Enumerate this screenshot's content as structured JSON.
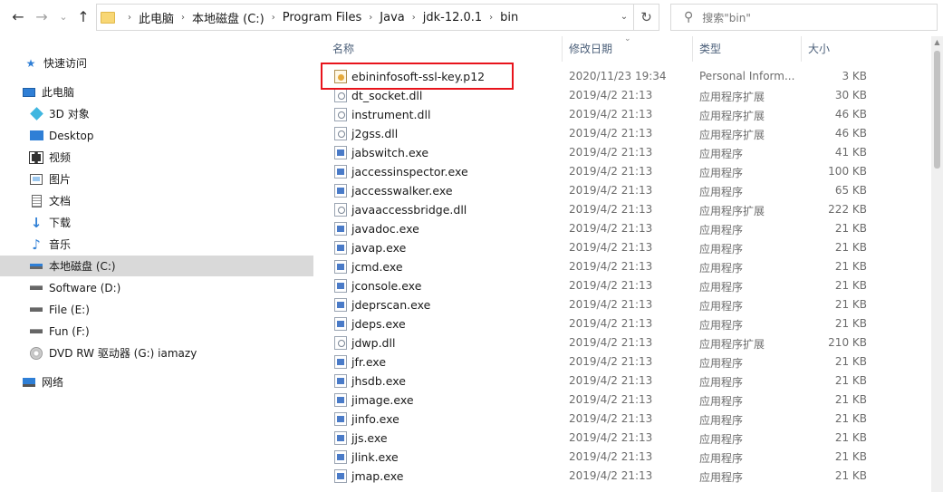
{
  "nav": {
    "back": "←",
    "forward": "→",
    "history": "⌄",
    "up": "↑"
  },
  "address": {
    "crumbs": [
      "此电脑",
      "本地磁盘 (C:)",
      "Program Files",
      "Java",
      "jdk-12.0.1",
      "bin"
    ],
    "refresh": "↻",
    "dropdown": "⌄"
  },
  "search": {
    "placeholder": "搜索\"bin\"",
    "icon": "search-icon"
  },
  "sidebar": {
    "quick_access": "快速访问",
    "this_pc": "此电脑",
    "items": [
      "3D 对象",
      "Desktop",
      "视频",
      "图片",
      "文档",
      "下载",
      "音乐",
      "本地磁盘 (C:)",
      "Software (D:)",
      "File (E:)",
      "Fun (F:)",
      "DVD RW 驱动器 (G:) iamazy"
    ],
    "network": "网络"
  },
  "columns": {
    "name": "名称",
    "date": "修改日期",
    "type": "类型",
    "size": "大小"
  },
  "files": [
    {
      "name": "ebininfosoft-ssl-key.p12",
      "date": "2020/11/23 19:34",
      "type": "Personal Inform...",
      "size": "3 KB",
      "kind": "cert"
    },
    {
      "name": "dt_socket.dll",
      "date": "2019/4/2 21:13",
      "type": "应用程序扩展",
      "size": "30 KB",
      "kind": "dll"
    },
    {
      "name": "instrument.dll",
      "date": "2019/4/2 21:13",
      "type": "应用程序扩展",
      "size": "46 KB",
      "kind": "dll"
    },
    {
      "name": "j2gss.dll",
      "date": "2019/4/2 21:13",
      "type": "应用程序扩展",
      "size": "46 KB",
      "kind": "dll"
    },
    {
      "name": "jabswitch.exe",
      "date": "2019/4/2 21:13",
      "type": "应用程序",
      "size": "41 KB",
      "kind": "exe"
    },
    {
      "name": "jaccessinspector.exe",
      "date": "2019/4/2 21:13",
      "type": "应用程序",
      "size": "100 KB",
      "kind": "exe"
    },
    {
      "name": "jaccesswalker.exe",
      "date": "2019/4/2 21:13",
      "type": "应用程序",
      "size": "65 KB",
      "kind": "exe"
    },
    {
      "name": "javaaccessbridge.dll",
      "date": "2019/4/2 21:13",
      "type": "应用程序扩展",
      "size": "222 KB",
      "kind": "dll"
    },
    {
      "name": "javadoc.exe",
      "date": "2019/4/2 21:13",
      "type": "应用程序",
      "size": "21 KB",
      "kind": "exe"
    },
    {
      "name": "javap.exe",
      "date": "2019/4/2 21:13",
      "type": "应用程序",
      "size": "21 KB",
      "kind": "exe"
    },
    {
      "name": "jcmd.exe",
      "date": "2019/4/2 21:13",
      "type": "应用程序",
      "size": "21 KB",
      "kind": "exe"
    },
    {
      "name": "jconsole.exe",
      "date": "2019/4/2 21:13",
      "type": "应用程序",
      "size": "21 KB",
      "kind": "exe"
    },
    {
      "name": "jdeprscan.exe",
      "date": "2019/4/2 21:13",
      "type": "应用程序",
      "size": "21 KB",
      "kind": "exe"
    },
    {
      "name": "jdeps.exe",
      "date": "2019/4/2 21:13",
      "type": "应用程序",
      "size": "21 KB",
      "kind": "exe"
    },
    {
      "name": "jdwp.dll",
      "date": "2019/4/2 21:13",
      "type": "应用程序扩展",
      "size": "210 KB",
      "kind": "dll"
    },
    {
      "name": "jfr.exe",
      "date": "2019/4/2 21:13",
      "type": "应用程序",
      "size": "21 KB",
      "kind": "exe"
    },
    {
      "name": "jhsdb.exe",
      "date": "2019/4/2 21:13",
      "type": "应用程序",
      "size": "21 KB",
      "kind": "exe"
    },
    {
      "name": "jimage.exe",
      "date": "2019/4/2 21:13",
      "type": "应用程序",
      "size": "21 KB",
      "kind": "exe"
    },
    {
      "name": "jinfo.exe",
      "date": "2019/4/2 21:13",
      "type": "应用程序",
      "size": "21 KB",
      "kind": "exe"
    },
    {
      "name": "jjs.exe",
      "date": "2019/4/2 21:13",
      "type": "应用程序",
      "size": "21 KB",
      "kind": "exe"
    },
    {
      "name": "jlink.exe",
      "date": "2019/4/2 21:13",
      "type": "应用程序",
      "size": "21 KB",
      "kind": "exe"
    },
    {
      "name": "jmap.exe",
      "date": "2019/4/2 21:13",
      "type": "应用程序",
      "size": "21 KB",
      "kind": "exe"
    }
  ],
  "colors": {
    "highlight": "#e8141c",
    "selected_bg": "#d9d9d9",
    "header_text": "#4c607a"
  }
}
